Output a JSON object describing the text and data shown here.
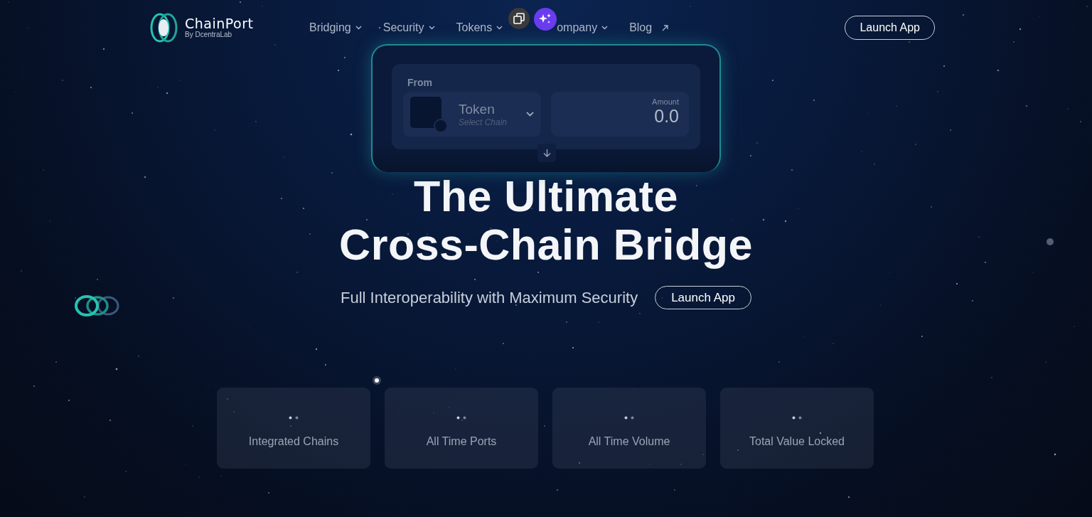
{
  "logo": {
    "name": "ChainPort",
    "tagline": "By DcentraLab"
  },
  "nav": [
    {
      "label": "Bridging",
      "kind": "dropdown"
    },
    {
      "label": "Security",
      "kind": "dropdown"
    },
    {
      "label": "Tokens",
      "kind": "dropdown"
    },
    {
      "label": "ompany",
      "kind": "dropdown"
    },
    {
      "label": "Blog",
      "kind": "external"
    }
  ],
  "header_button": "Launch App",
  "bridge_preview": {
    "section_label": "From",
    "token": "Token",
    "chain_placeholder": "Select Chain",
    "amount_label": "Amount",
    "amount": "0.0"
  },
  "hero": {
    "title_lines": [
      "The Ultimate",
      "Cross-Chain Bridge"
    ],
    "subtitle": "Full Interoperability with Maximum Security",
    "button": "Launch App"
  },
  "stats": [
    {
      "label": "Integrated Chains"
    },
    {
      "label": "All Time Ports"
    },
    {
      "label": "All Time Volume"
    },
    {
      "label": "Total Value Locked"
    }
  ]
}
